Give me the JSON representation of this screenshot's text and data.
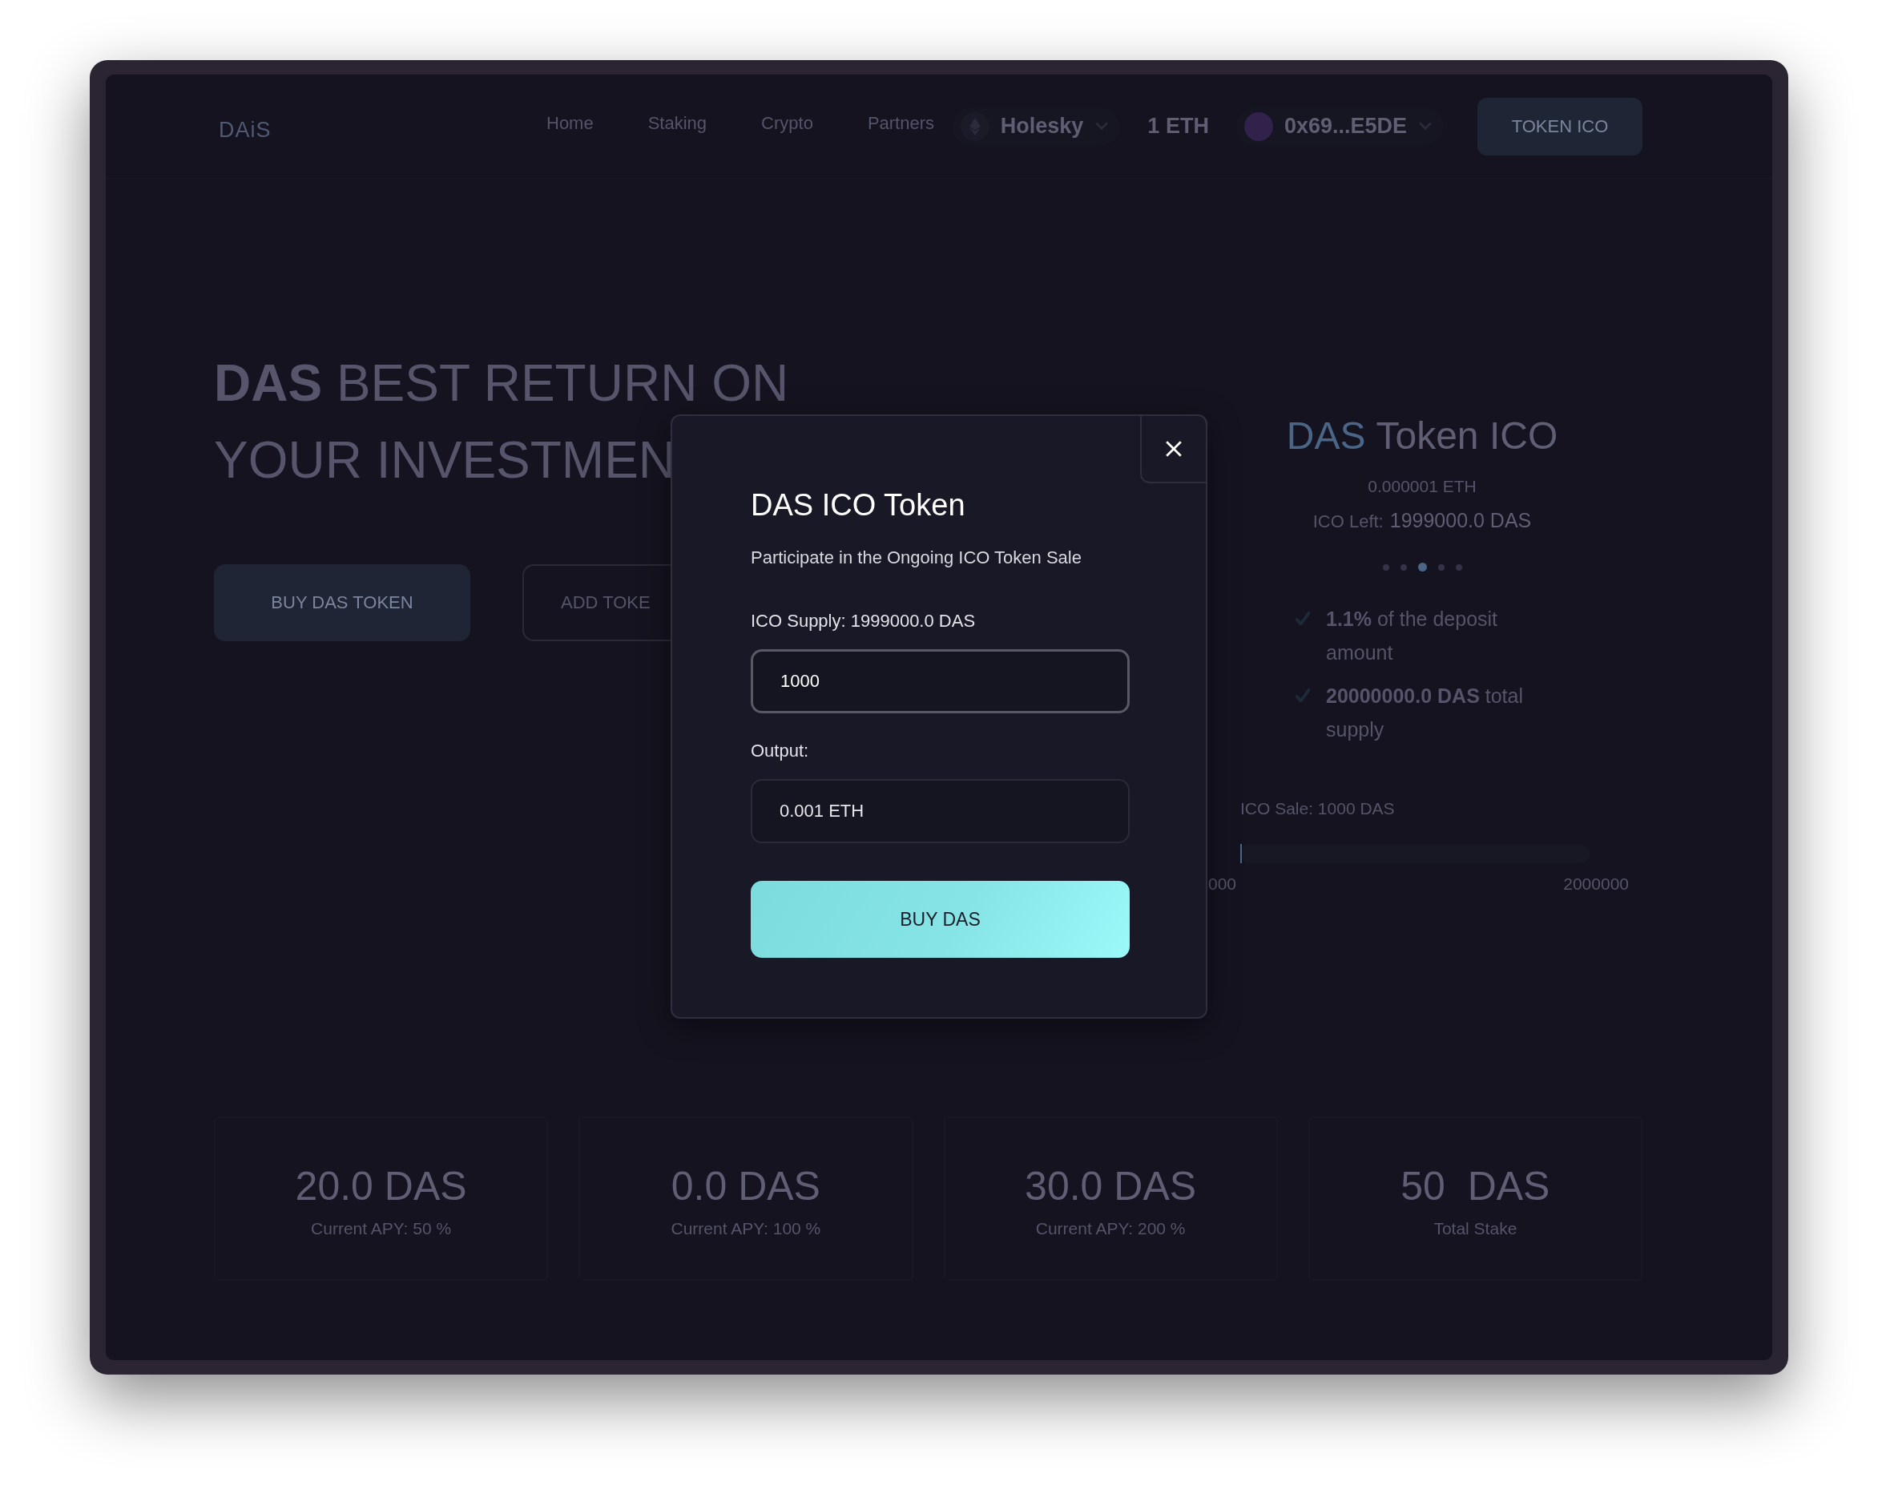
{
  "nav": {
    "logo": "DAiS",
    "links": [
      {
        "label": "Home"
      },
      {
        "label": "Staking"
      },
      {
        "label": "Crypto"
      },
      {
        "label": "Partners"
      }
    ],
    "network": {
      "name": "Holesky"
    },
    "balance": "1 ETH",
    "account": {
      "address": "0x69...E5DE"
    },
    "cta": "TOKEN ICO"
  },
  "hero": {
    "heading_line_1": "**DAS** BEST RETURN ON",
    "heading_line_2": "YOUR INVESTMEN",
    "buttons": [
      {
        "label": "BUY DAS TOKEN",
        "kind": "filled"
      },
      {
        "label": "ADD TOKE",
        "kind": "outline"
      }
    ]
  },
  "ico_card": {
    "title_prefix": "DAS",
    "title": "Token ICO",
    "price": "0.000001 ETH",
    "ico_left_label": "ICO Left:",
    "ico_left_value": "1999000.0 DAS",
    "carousel_dots": [
      {
        "selected": false
      },
      {
        "selected": false
      },
      {
        "selected": true
      },
      {
        "selected": false
      },
      {
        "selected": false
      }
    ],
    "features": [
      "**1.1%** of the deposit amount",
      "**20000000.0 DAS** total supply"
    ],
    "sale": {
      "label": "ICO Sale: 1000 DAS",
      "level": 0.0005,
      "min_label": "000",
      "max_label": "2000000"
    }
  },
  "stats": [
    {
      "value": "20.0 DAS",
      "caption": "Current APY: 50 %"
    },
    {
      "value": "0.0 DAS",
      "caption": "Current APY: 100 %"
    },
    {
      "value": "30.0 DAS",
      "caption": "Current APY: 200 %"
    },
    {
      "value": "50  DAS",
      "caption": "Total Stake"
    }
  ],
  "modal": {
    "title": "DAS ICO Token",
    "subtitle": "Participate in the Ongoing ICO Token Sale",
    "supply_label": "ICO Supply: 1999000.0 DAS",
    "amount_value": "1000",
    "output_label": "Output:",
    "output_value": "0.001 ETH",
    "submit": "BUY DAS"
  }
}
